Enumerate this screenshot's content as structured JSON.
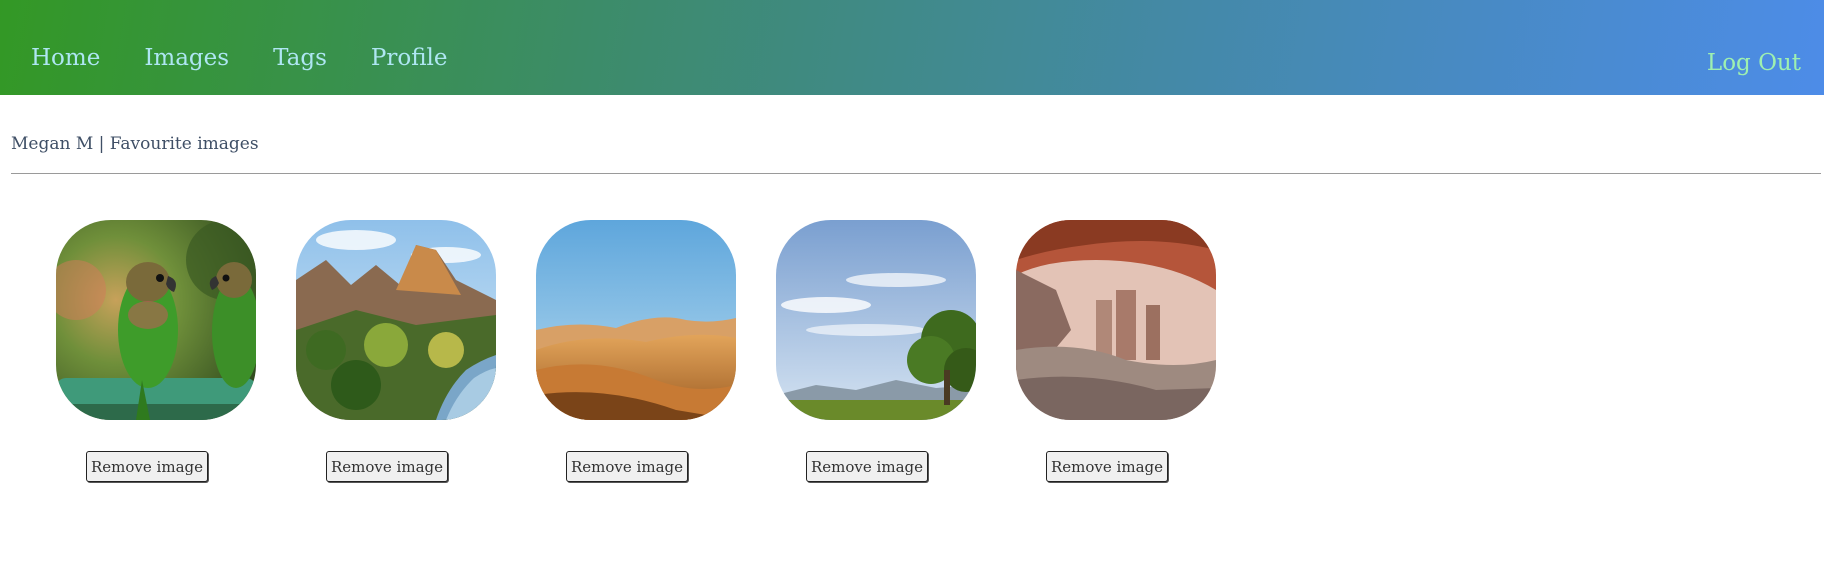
{
  "nav": {
    "items": [
      {
        "label": "Home"
      },
      {
        "label": "Images"
      },
      {
        "label": "Tags"
      },
      {
        "label": "Profile"
      }
    ],
    "logout_label": "Log Out"
  },
  "page": {
    "header": "Megan M | Favourite images"
  },
  "gallery": {
    "items": [
      {
        "image": "parrots-photo",
        "button_label": "Remove image"
      },
      {
        "image": "canyon-river-photo",
        "button_label": "Remove image"
      },
      {
        "image": "desert-dunes-photo",
        "button_label": "Remove image"
      },
      {
        "image": "tree-sky-photo",
        "button_label": "Remove image"
      },
      {
        "image": "rock-arch-photo",
        "button_label": "Remove image"
      }
    ]
  },
  "colors": {
    "nav_gradient_start": "#339825",
    "nav_gradient_end": "#4d8ce8",
    "nav_link": "#aee6f2",
    "logout_link": "#9ef0b0",
    "header_text": "#3f4f66"
  }
}
